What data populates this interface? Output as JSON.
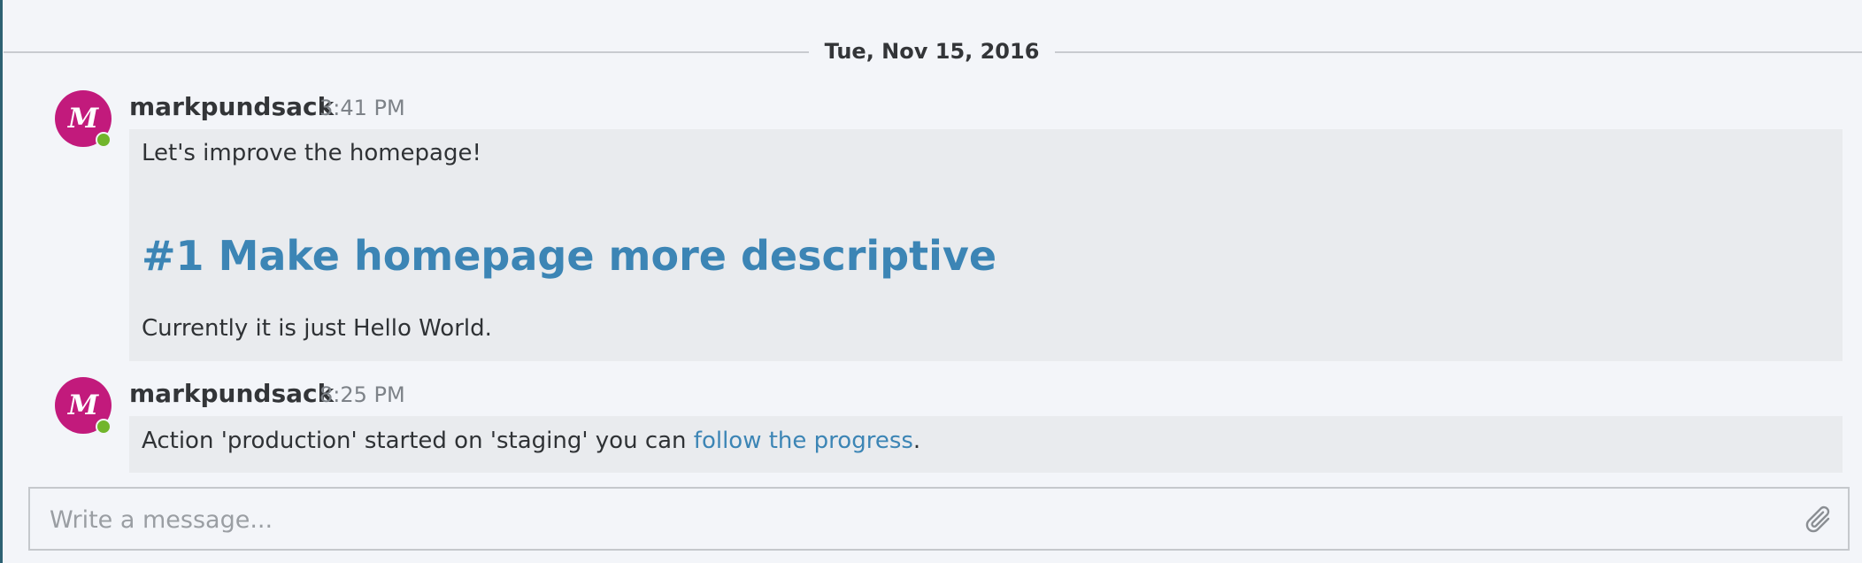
{
  "date_divider": {
    "label": "Tue, Nov 15, 2016"
  },
  "messages": [
    {
      "avatar_letter": "M",
      "author": "markpundsack",
      "time": "3:41 PM",
      "intro": "Let's improve the homepage!",
      "heading": "#1 Make homepage more descriptive",
      "body": "Currently it is just Hello World."
    },
    {
      "avatar_letter": "M",
      "author": "markpundsack",
      "time": "8:25 PM",
      "text_before": "Action 'production' started on 'staging' you can ",
      "link_text": "follow the progress",
      "text_after": "."
    }
  ],
  "composer": {
    "placeholder": "Write a message..."
  },
  "icons": {
    "attach": "paperclip-icon"
  },
  "colors": {
    "avatar": "#c21a7c",
    "online_status": "#71b52c",
    "link": "#3c85b5",
    "bubble": "#e9ebee",
    "background": "#f3f5f9"
  }
}
